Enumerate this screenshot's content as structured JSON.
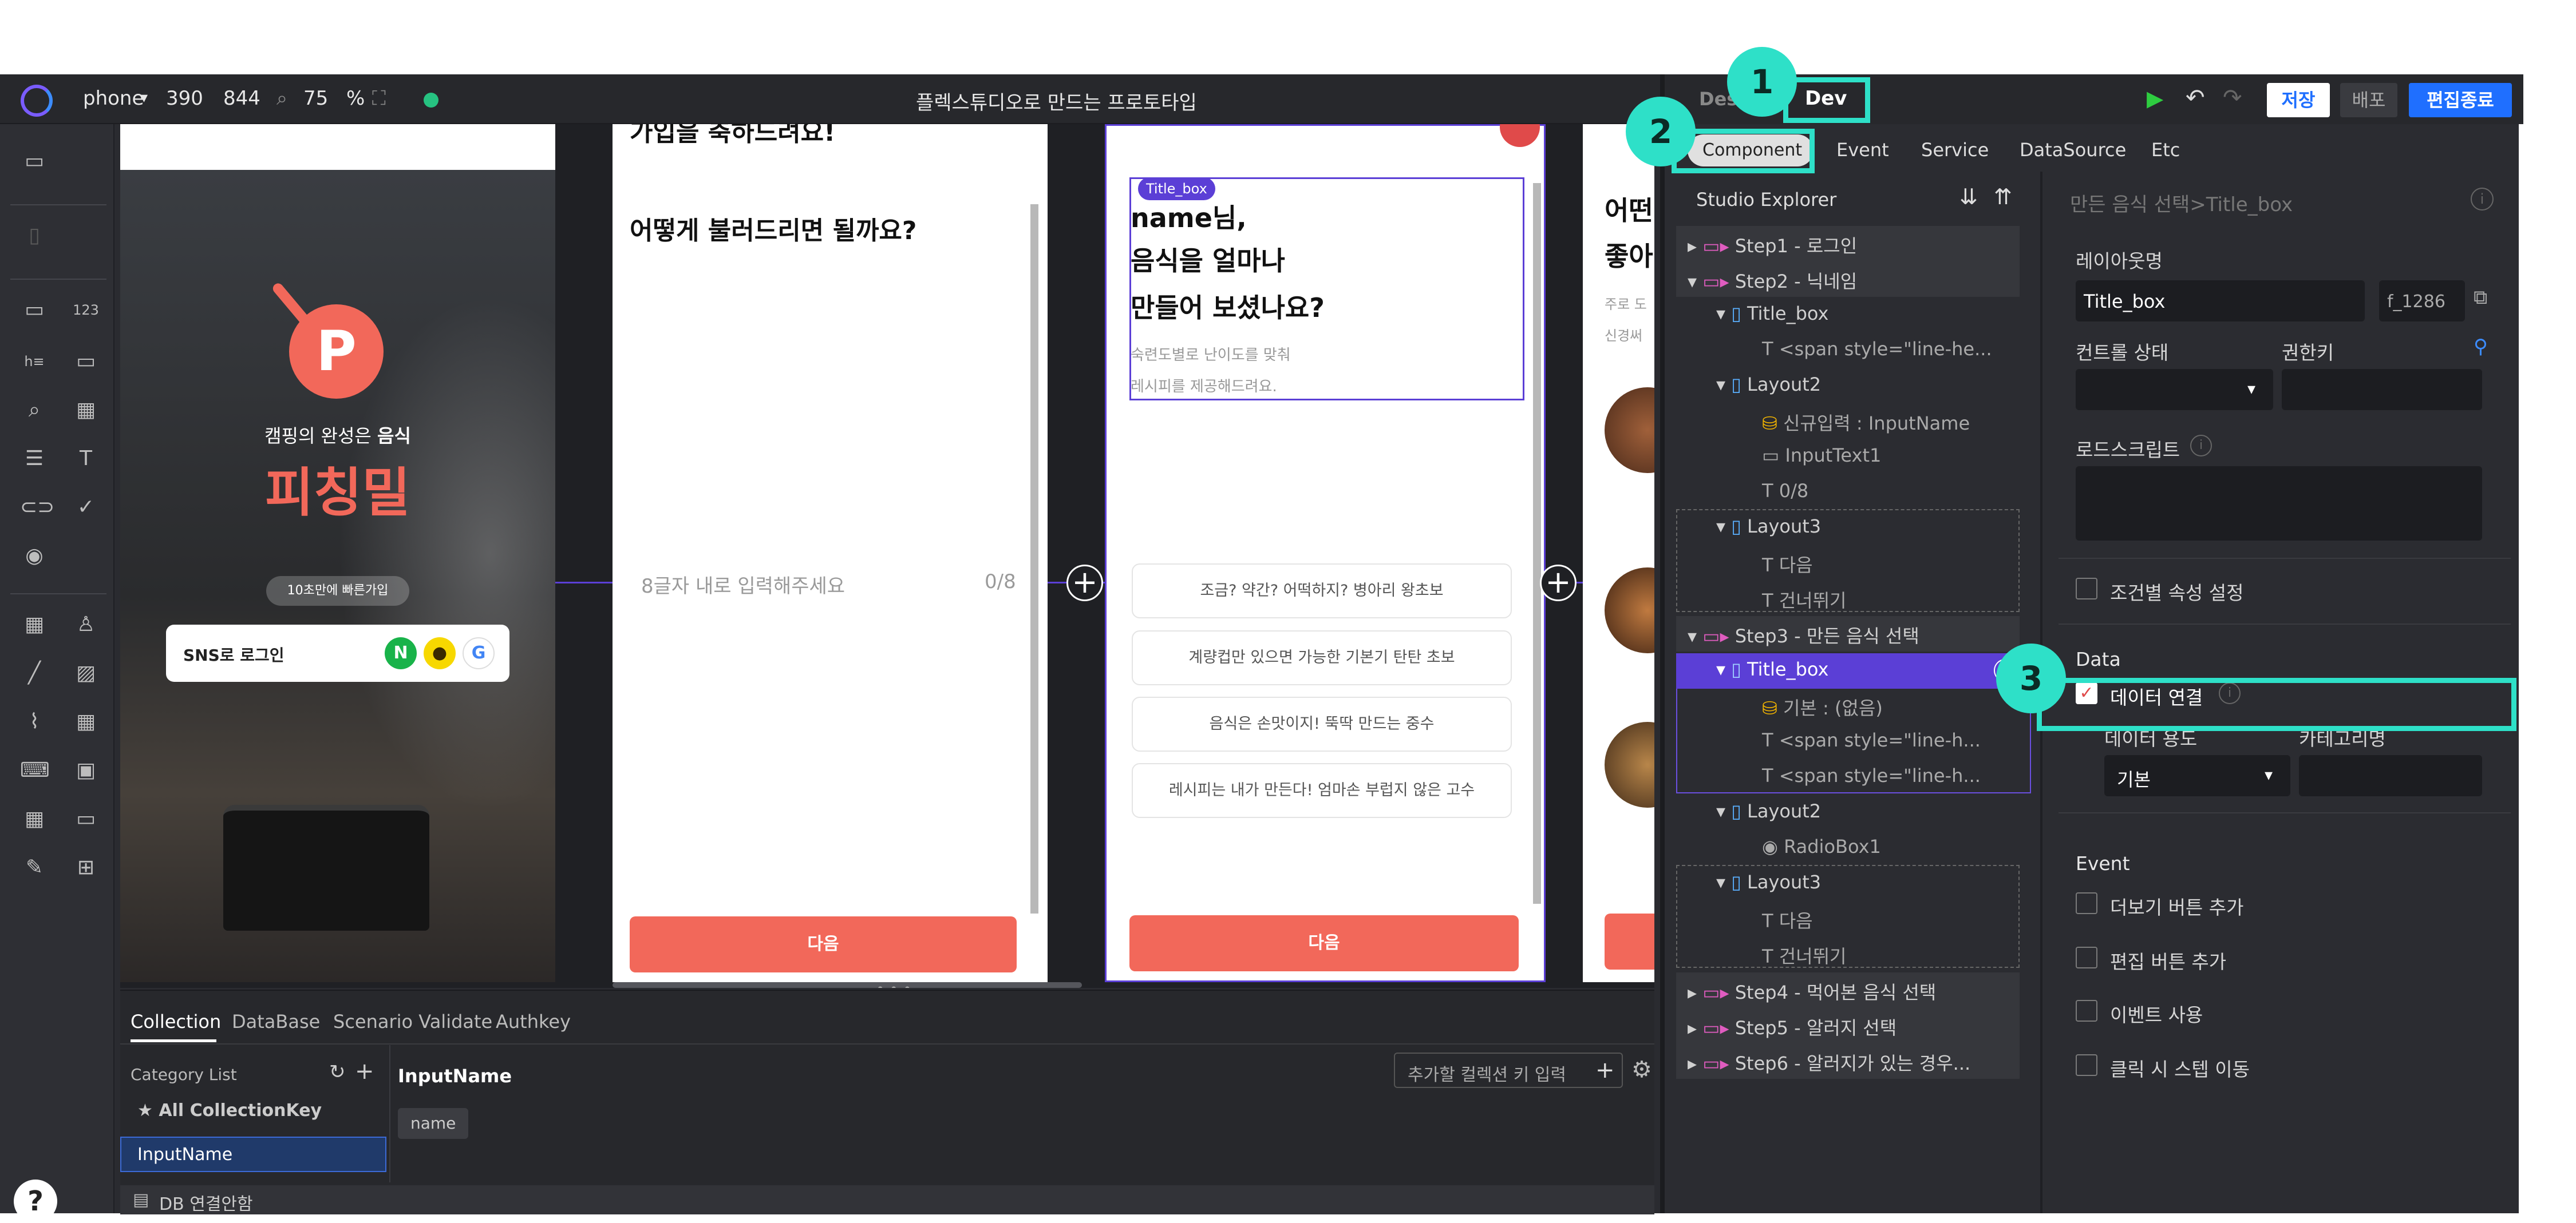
{
  "topbar": {
    "device": "phone",
    "width": "390",
    "height": "844",
    "zoom": "75",
    "zoom_unit": "%",
    "title": "플렉스튜디오로 만드는 프로토타입",
    "mode_design": "Design",
    "mode_dev": "Dev",
    "save": "저장",
    "deploy": "배포",
    "exit": "편집종료"
  },
  "phone1": {
    "tagline_pre": "캠핑의 완성은 ",
    "tagline_bold": "음식",
    "brand": "피칭밀",
    "promo": "10초만에 빠른가입",
    "sns_login": "SNS로 로그인"
  },
  "phone2": {
    "heading_cut": "가입을 축하드려요!",
    "heading": "어떻게 불러드리면 될까요?",
    "placeholder": "8글자 내로 입력해주세요",
    "counter": "0/8",
    "next": "다음"
  },
  "phone3": {
    "selection_tag": "Title_box",
    "line1": "name님,",
    "line2": "음식을 얼마나",
    "line3": "만들어 보셨나요?",
    "sub1": "숙련도별로 난이도를 맞춰",
    "sub2": "레시피를 제공해드려요.",
    "options": [
      "조금? 약간? 어떡하지? 병아리 왕초보",
      "계량컵만 있으면 가능한 기본기 탄탄 초보",
      "음식은 손맛이지! 뚝딱 만드는 중수",
      "레시피는 내가 만든다! 엄마손 부럽지 않은 고수"
    ],
    "next": "다음"
  },
  "phone4": {
    "line1": "어떤",
    "line2": "좋아",
    "sub1": "주로 도",
    "sub2": "신경써"
  },
  "bottom": {
    "tabs": [
      "Collection",
      "DataBase",
      "Scenario Validate",
      "Authkey"
    ],
    "category_list": "Category List",
    "all_key": "★ All CollectionKey",
    "selected_key": "InputName",
    "detail_title": "InputName",
    "key_placeholder": "추가할 컬렉션 키 입력",
    "chip": "name",
    "db_status": "DB 연결안함"
  },
  "dev": {
    "tabs": [
      "Component",
      "Event",
      "Service",
      "DataSource",
      "Etc"
    ],
    "explorer_title": "Studio Explorer",
    "tree": [
      "Step1 - 로그인",
      "Step2 - 닉네임",
      "Title_box",
      "<span style=\"line-he...",
      "Layout2",
      "신규입력 : InputName",
      "InputText1",
      "0/8",
      "Layout3",
      "다음",
      "건너뛰기",
      "Step3 - 만든 음식 선택",
      "Title_box",
      "기본 : (없음)",
      "<span style=\"line-h...",
      "<span style=\"line-h...",
      "Layout2",
      "RadioBox1",
      "Layout3",
      "다음",
      "건너뛰기",
      "Step4 - 먹어본 음식 선택",
      "Step5 - 알러지 선택",
      "Step6 - 알러지가 있는 경우..."
    ],
    "breadcrumb": "만든 음식 선택>Title_box",
    "layout_name_label": "레이아웃명",
    "layout_name": "Title_box",
    "layout_id": "f_1286",
    "control_state": "컨트롤 상태",
    "permission_key": "권한키",
    "load_script": "로드스크립트",
    "conditional_attr": "조건별 속성 설정",
    "data_section": "Data",
    "data_link": "데이터 연결",
    "data_usage": "데이터 용도",
    "category": "카테고리명",
    "usage_value": "기본",
    "event_section": "Event",
    "events": [
      "더보기 버튼 추가",
      "편집 버튼 추가",
      "이벤트 사용",
      "클릭 시 스텝 이동"
    ]
  },
  "callouts": [
    "1",
    "2",
    "3"
  ],
  "colors": {
    "accent": "#2ee0c8",
    "brand": "#f2685a",
    "primary_blue": "#1f6fff",
    "selection": "#5b3fd6"
  }
}
